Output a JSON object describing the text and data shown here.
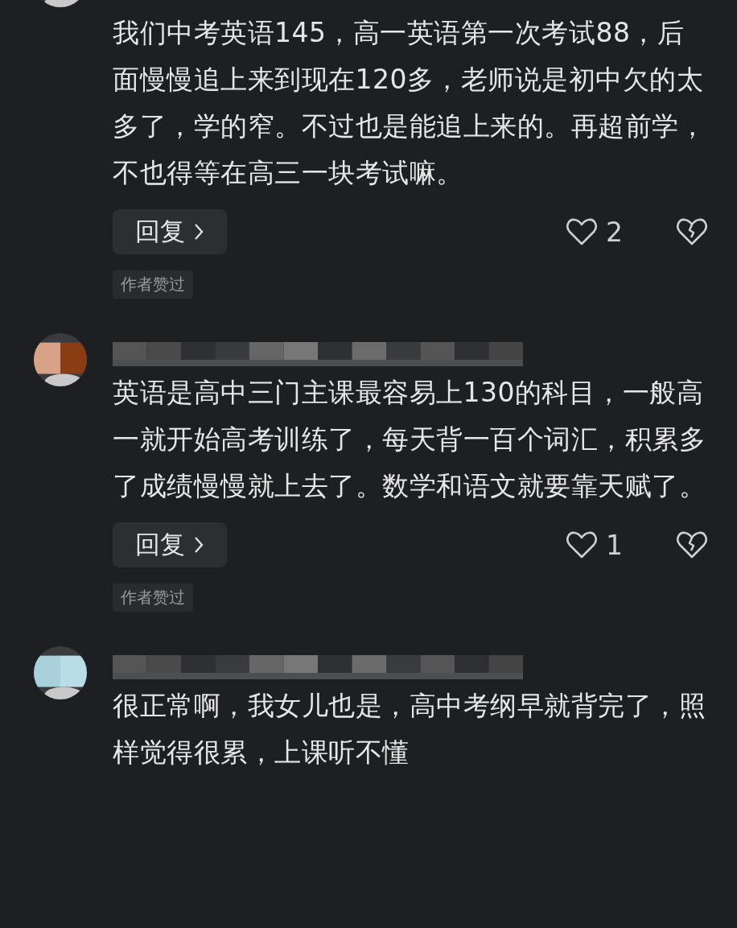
{
  "comments": [
    {
      "text": "我们中考英语145，高一英语第一次考试88，后面慢慢追上来到现在120多，老师说是初中欠的太多了，学的窄。不过也是能追上来的。再超前学，不也得等在高三一块考试嘛。",
      "reply": "回复",
      "likes": "2",
      "badge": "作者赞过"
    },
    {
      "text": "英语是高中三门主课最容易上130的科目，一般高一就开始高考训练了，每天背一百个词汇，积累多了成绩慢慢就上去了。数学和语文就要靠天赋了。",
      "reply": "回复",
      "likes": "1",
      "badge": "作者赞过"
    },
    {
      "text": "很正常啊，我女儿也是，高中考纲早就背完了，照样觉得很累，上课听不懂"
    }
  ]
}
